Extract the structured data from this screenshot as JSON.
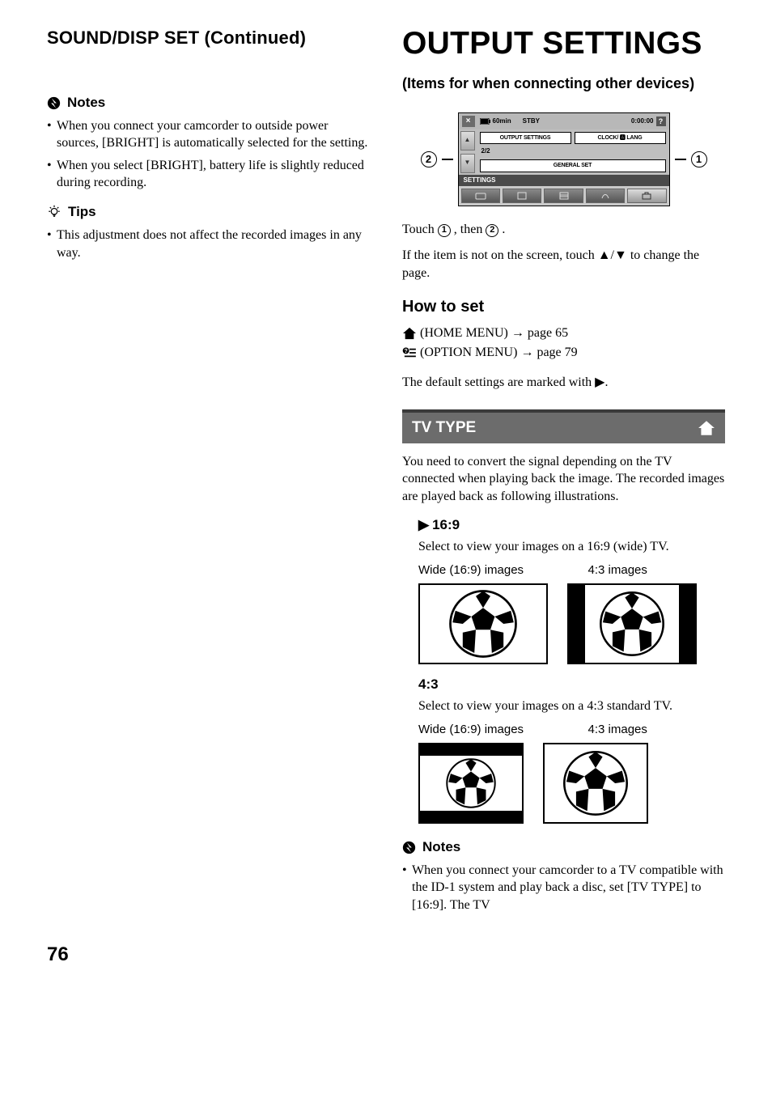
{
  "left": {
    "breadcrumb": "SOUND/DISP SET (Continued)",
    "notes_heading": "Notes",
    "notes": [
      "When you connect your camcorder to outside power sources, [BRIGHT] is automatically selected for the setting.",
      "When you select [BRIGHT], battery life is slightly reduced during recording."
    ],
    "tips_heading": "Tips",
    "tips": [
      "This adjustment does not affect the recorded images in any way."
    ]
  },
  "right": {
    "title": "OUTPUT SETTINGS",
    "subtitle": "(Items for when connecting other devices)",
    "lcd": {
      "battery": "60min",
      "stby": "STBY",
      "time": "0:00:00",
      "tab_output": "OUTPUT SETTINGS",
      "tab_clock": "CLOCK/ 🅰 LANG",
      "page": "2/2",
      "tab_general": "GENERAL SET",
      "settings_label": "SETTINGS"
    },
    "callout_1": "1",
    "callout_2": "2",
    "touch_line_a": "Touch ",
    "touch_then": ", then ",
    "touch_period": ".",
    "touch_line_b": "If the item is not on the screen, touch ▲/▼ to change the page.",
    "how_to_set": "How to set",
    "home_menu": " (HOME MENU) ",
    "home_page": " page 65",
    "option_menu": "(OPTION MENU) ",
    "option_page": " page 79",
    "default_line": "The default settings are marked with ▶.",
    "tvtype_label": "TV TYPE",
    "tvtype_desc": "You need to convert the signal depending on the TV connected when playing back the image. The recorded images are played back as following illustrations.",
    "opt_169_title": "16:9",
    "opt_169_desc": "Select to view your images on a 16:9 (wide) TV.",
    "opt_43_title": "4:3",
    "opt_43_desc": "Select to view your images on a 4:3 standard TV.",
    "col_wide": "Wide (16:9) images",
    "col_43": "4:3 images",
    "notes2_heading": "Notes",
    "notes2": [
      "When you connect your camcorder to a TV compatible with the ID-1 system and play back a disc, set [TV TYPE] to [16:9]. The TV"
    ]
  },
  "page_number": "76"
}
